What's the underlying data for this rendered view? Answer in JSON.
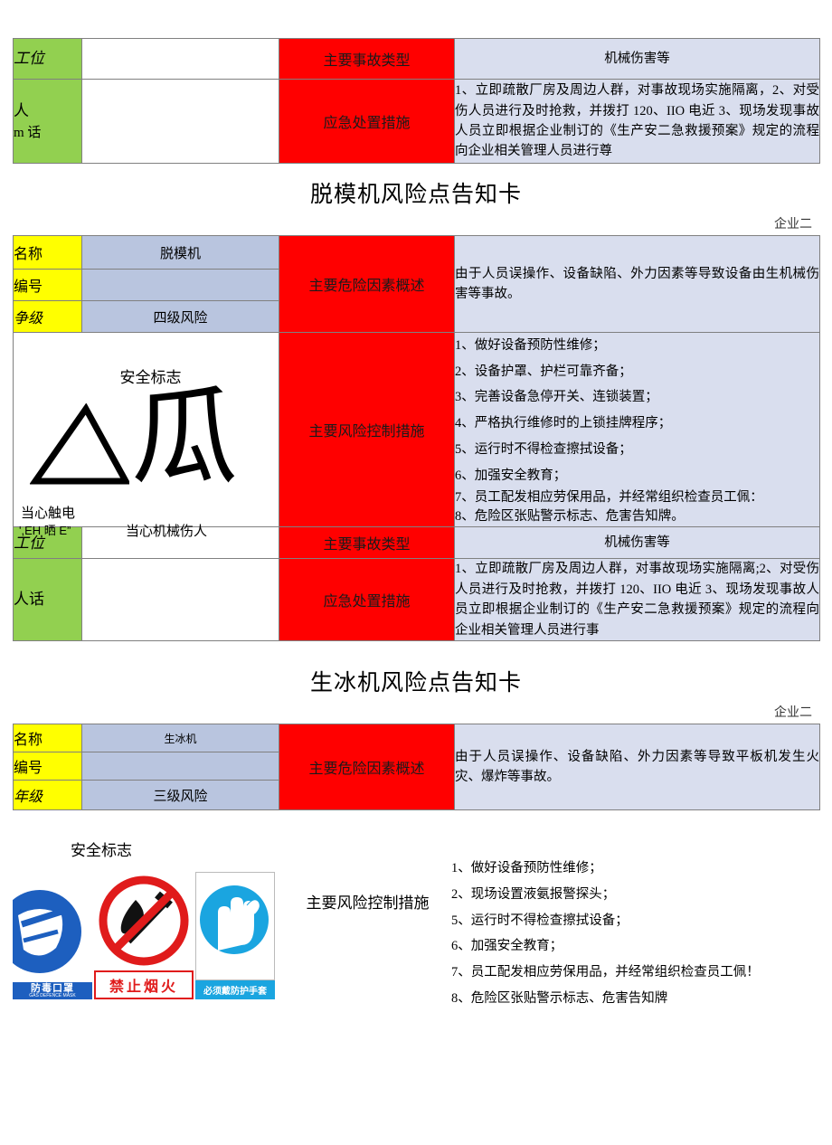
{
  "colors": {
    "red": "#FF0000",
    "yellow": "#FFFF00",
    "green": "#92D050",
    "blue_fill": "#B9C5DF",
    "light_blue_fill": "#D9DEEE",
    "border": "#808080"
  },
  "section_top": {
    "rows": [
      {
        "label": "工位",
        "value": "",
        "red_label": "主要事故类型",
        "content": "机械伤害等"
      },
      {
        "label_line1": "人",
        "label_line2": "m 话",
        "value": "",
        "red_label": "应急处置措施",
        "content": "1、立即疏散厂房及周边人群，对事故现场实施隔离，2、对受伤人员进行及时抢救，并拨打 120、IIO 电近 3、现场发现事故人员立即根据企业制订的《生产安二急救援预案》规定的流程向企业相关管理人员进行尊"
      }
    ]
  },
  "section_tuomoji": {
    "title": "脱模机风险点告知卡",
    "corp": "企业二",
    "labels": {
      "name": "名称",
      "code": "编号",
      "level": "争级"
    },
    "values": {
      "name": "脱模机",
      "code": "",
      "level": "四级风险"
    },
    "hazard_label": "主要危险因素概述",
    "hazard_text": "由于人员误操作、设备缺陷、外力因素等导致设备由生机械伤害等事故。",
    "safety_sign_title": "安全标志",
    "sign_glyph": "瓜",
    "sign_caption_left": "当心触电",
    "sign_caption_left_sub": "',ЕН 晒 E”",
    "sign_caption_right": "当心机械伤人",
    "control_label": "主要风险控制措施",
    "control_measures": [
      "1、做好设备预防性维修；",
      "2、设备护罩、护栏可靠齐备；",
      "3、完善设备急停开关、连锁装置；",
      "4、严格执行维修时的上锁挂牌程序；",
      "5、运行时不得检查擦拭设备；",
      "6、加强安全教育；",
      "7、员工配发相应劳保用品，并经常组织检查员工佩：",
      "8、危险区张贴警示标志、危害告知牌。"
    ],
    "footer_rows": [
      {
        "label": "工位",
        "value": "",
        "red_label": "主要事故类型",
        "content": "机械伤害等"
      },
      {
        "label": "人话",
        "value": "",
        "red_label": "应急处置措施",
        "content": "1、立即疏散厂房及周边人群，对事故现场实施隔离;2、对受伤人员进行及时抢救，并拨打 120、IIO 电近 3、现场发现事故人员立即根据企业制订的《生产安二急救援预案》规定的流程向企业相关管理人员进行事"
      }
    ]
  },
  "section_shengbingji": {
    "title": "生冰机风险点告知卡",
    "corp": "企业二",
    "labels": {
      "name": "名称",
      "code": "编号",
      "level": "年级"
    },
    "values": {
      "name": "生冰机",
      "code": "",
      "level": "三级风险"
    },
    "hazard_label": "主要危险因素概述",
    "hazard_text": "由于人员误操作、设备缺陷、外力因素等导致平板机发生火灾、爆炸等事故。",
    "safety_sign_title": "安全标志",
    "pictograms": [
      {
        "name": "gas-mask-icon",
        "label": "防毒口罩",
        "sublabel": "GAS DEFENCE MASK"
      },
      {
        "name": "no-fire-icon",
        "label": "禁止烟火",
        "sublabel": ""
      },
      {
        "name": "wear-gloves-icon",
        "label": "必须戴防护手套",
        "sublabel": ""
      }
    ],
    "control_label": "主要风险控制措施",
    "control_measures": [
      "1、做好设备预防性维修；",
      "2、现场设置液氨报警探头；",
      "5、运行时不得检查擦拭设备；",
      "6、加强安全教育；",
      "7、员工配发相应劳保用品，并经常组织检查员工佩！",
      "8、危险区张贴警示标志、危害告知牌"
    ]
  }
}
